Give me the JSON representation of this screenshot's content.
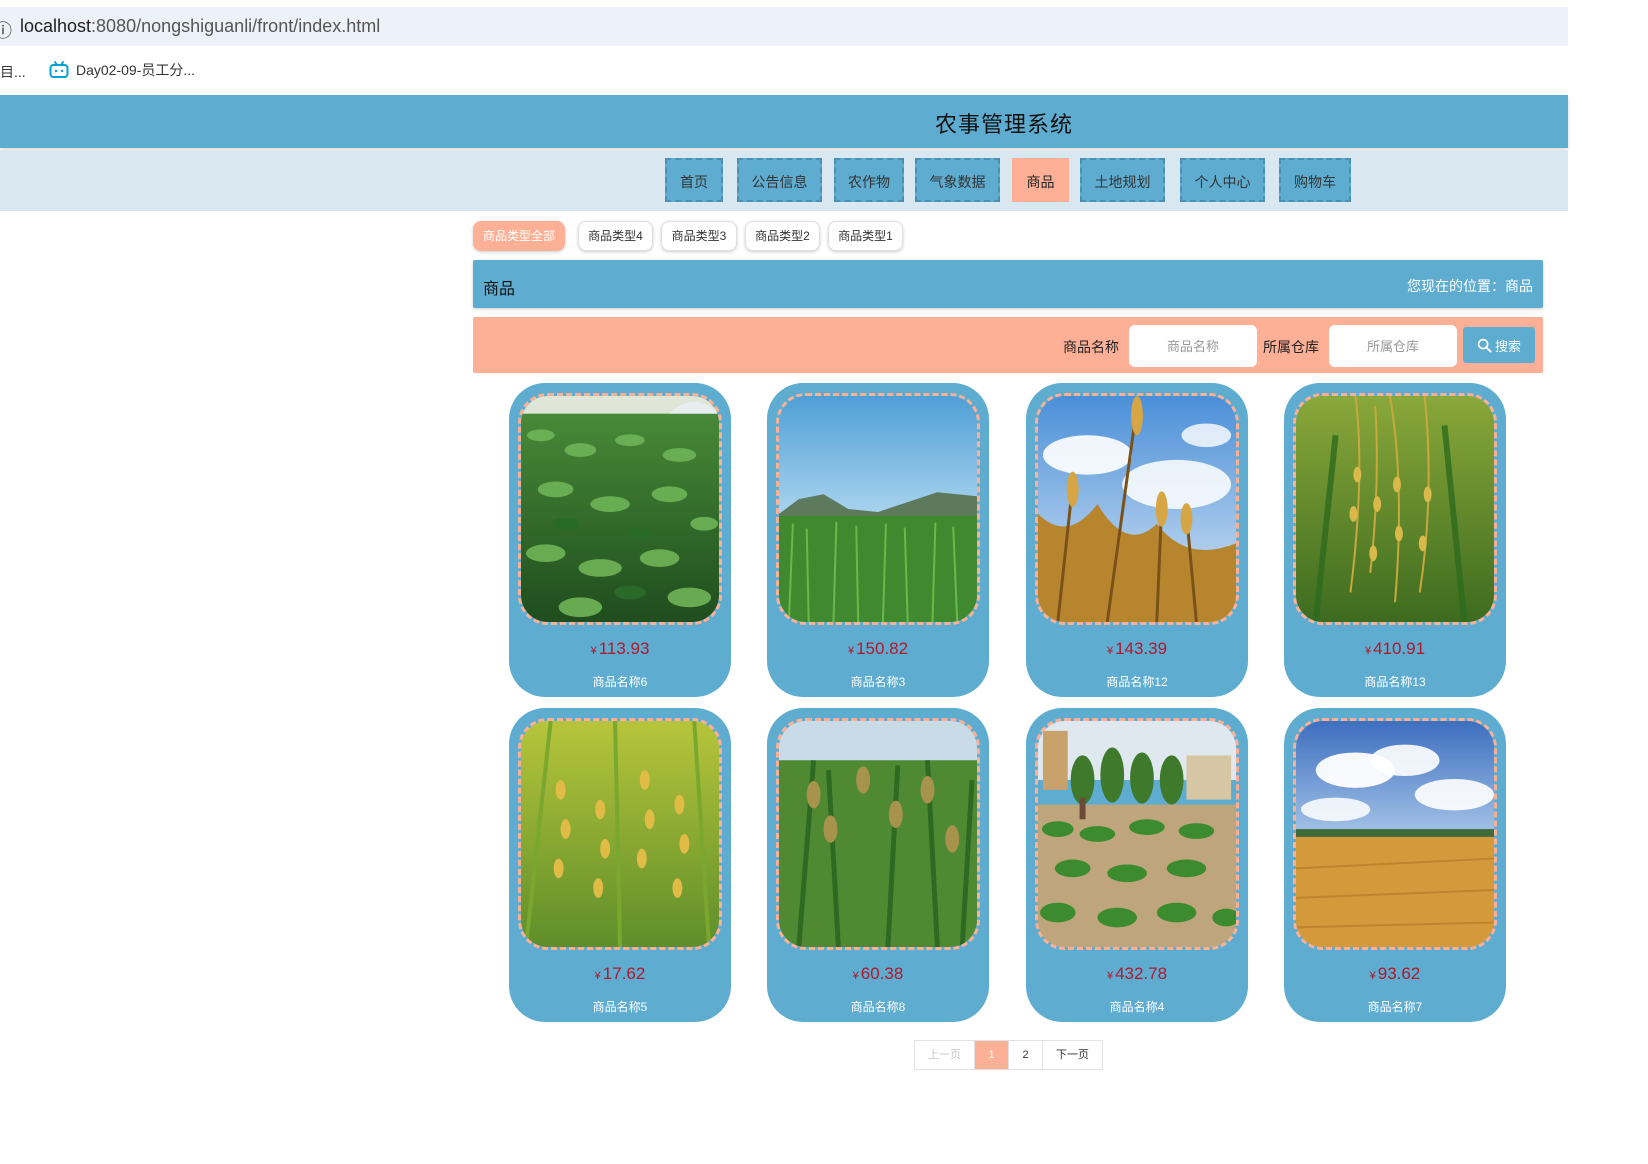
{
  "browser": {
    "url_host": "localhost",
    "url_rest": ":8080/nongshiguanli/front/index.html",
    "bookmark_cut_label": "目...",
    "bookmark_label": "Day02-09-员工分..."
  },
  "site": {
    "title": "农事管理系统"
  },
  "nav": {
    "items": [
      {
        "label": "首页"
      },
      {
        "label": "公告信息"
      },
      {
        "label": "农作物"
      },
      {
        "label": "气象数据"
      },
      {
        "label": "商品"
      },
      {
        "label": "土地规划"
      },
      {
        "label": "个人中心"
      },
      {
        "label": "购物车"
      }
    ],
    "active": "商品"
  },
  "categories": {
    "tabs": [
      {
        "label": "商品类型全部"
      },
      {
        "label": "商品类型4"
      },
      {
        "label": "商品类型3"
      },
      {
        "label": "商品类型2"
      },
      {
        "label": "商品类型1"
      }
    ],
    "active": "商品类型全部"
  },
  "breadcrumb": {
    "title": "商品",
    "location": "您现在的位置：商品"
  },
  "search": {
    "name_label": "商品名称",
    "name_placeholder": "商品名称",
    "warehouse_label": "所属仓库",
    "warehouse_placeholder": "所属仓库",
    "button_label": "搜索"
  },
  "currency_symbol": "¥",
  "products": [
    {
      "price": "113.93",
      "name": "商品名称6",
      "image": "tea-field"
    },
    {
      "price": "150.82",
      "name": "商品名称3",
      "image": "green-wheat-field"
    },
    {
      "price": "143.39",
      "name": "商品名称12",
      "image": "golden-wheat-sky"
    },
    {
      "price": "410.91",
      "name": "商品名称13",
      "image": "rice-ears"
    },
    {
      "price": "17.62",
      "name": "商品名称5",
      "image": "rice-closeup"
    },
    {
      "price": "60.38",
      "name": "商品名称8",
      "image": "millet-field"
    },
    {
      "price": "432.78",
      "name": "商品名称4",
      "image": "vegetable-field"
    },
    {
      "price": "93.62",
      "name": "商品名称7",
      "image": "wheat-field-clouds"
    }
  ],
  "pagination": {
    "prev_label": "上一页",
    "pages": [
      "1",
      "2"
    ],
    "current": "1",
    "next_label": "下一页"
  },
  "colors": {
    "primary": "#5eadd1",
    "accent": "#fdb096",
    "nav_bg": "#d8e7f0",
    "price": "#b2172b"
  }
}
